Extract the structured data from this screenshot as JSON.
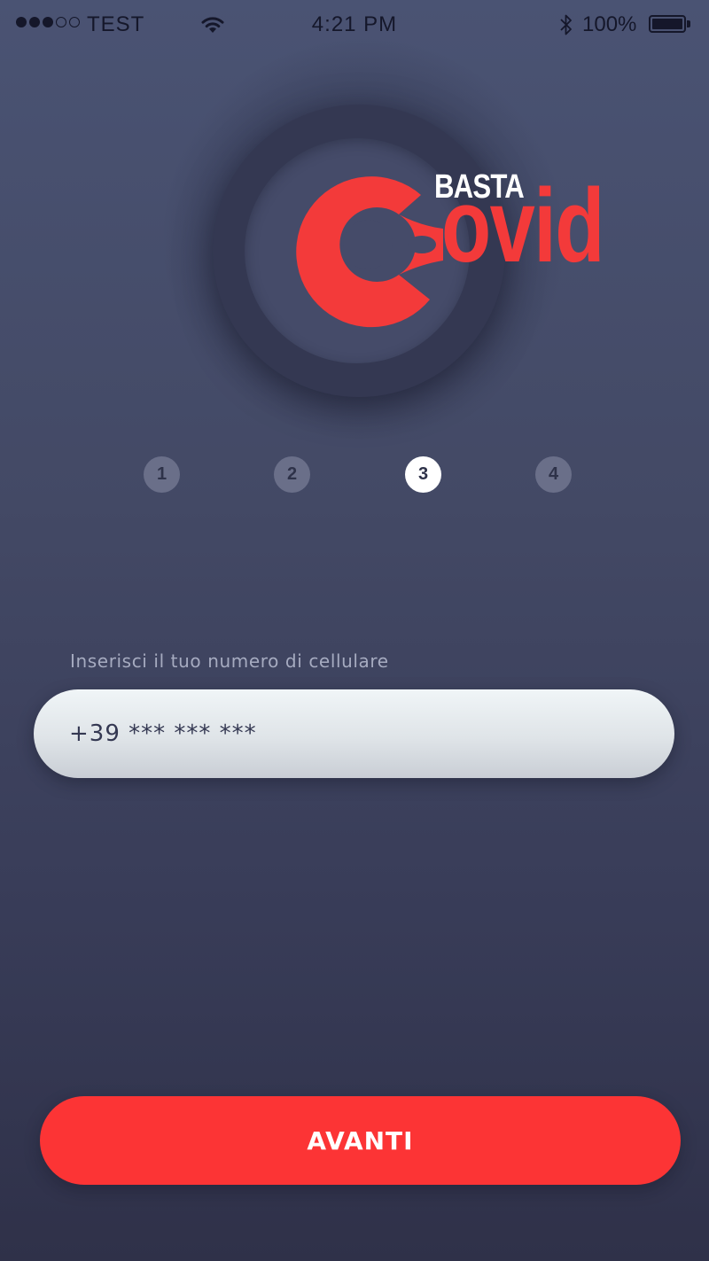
{
  "status_bar": {
    "carrier": "TEST",
    "time": "4:21 PM",
    "battery_percent": "100%",
    "signal_bars_filled": 3,
    "signal_bars_total": 5,
    "icons": [
      "signal-dots-icon",
      "wifi-icon",
      "bluetooth-icon",
      "battery-icon"
    ]
  },
  "logo": {
    "line1": "BASTA",
    "line2": "ovid",
    "brand_color": "#f33a3a"
  },
  "stepper": {
    "steps": [
      "1",
      "2",
      "3",
      "4"
    ],
    "active_step": 3
  },
  "phone_form": {
    "label": "Inserisci il tuo numero di cellulare",
    "placeholder": "+39 *** *** ***",
    "value": ""
  },
  "actions": {
    "next_label": "AVANTI"
  },
  "colors": {
    "background_top": "#4a5373",
    "background_bottom": "#2f3149",
    "accent": "#fc3435",
    "step_inactive": "#6a6f89",
    "step_active": "#ffffff",
    "label": "#a6abc0"
  }
}
